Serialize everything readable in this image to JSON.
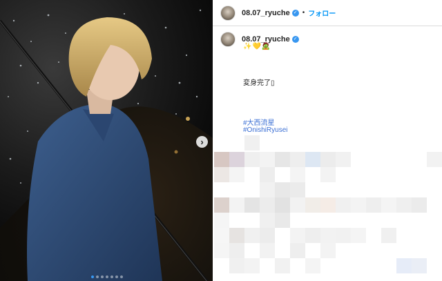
{
  "post": {
    "username": "08.07_ryuche",
    "follow_label": "フォロー",
    "separator": "•",
    "caption_user": "08.07_ryuche",
    "caption_emojis": "✨💛🧟",
    "caption_text": "変身完了▯",
    "hashtags": [
      "#大西流星",
      "#OnishiRyusei"
    ],
    "carousel_count": 7,
    "carousel_active": 0
  },
  "colors": {
    "accent": "#3897f0",
    "follow": "#0095f6",
    "hashtag": "#3b6fd4"
  },
  "icons": {
    "verified": "verified-badge-icon",
    "next": "chevron-right-icon"
  }
}
